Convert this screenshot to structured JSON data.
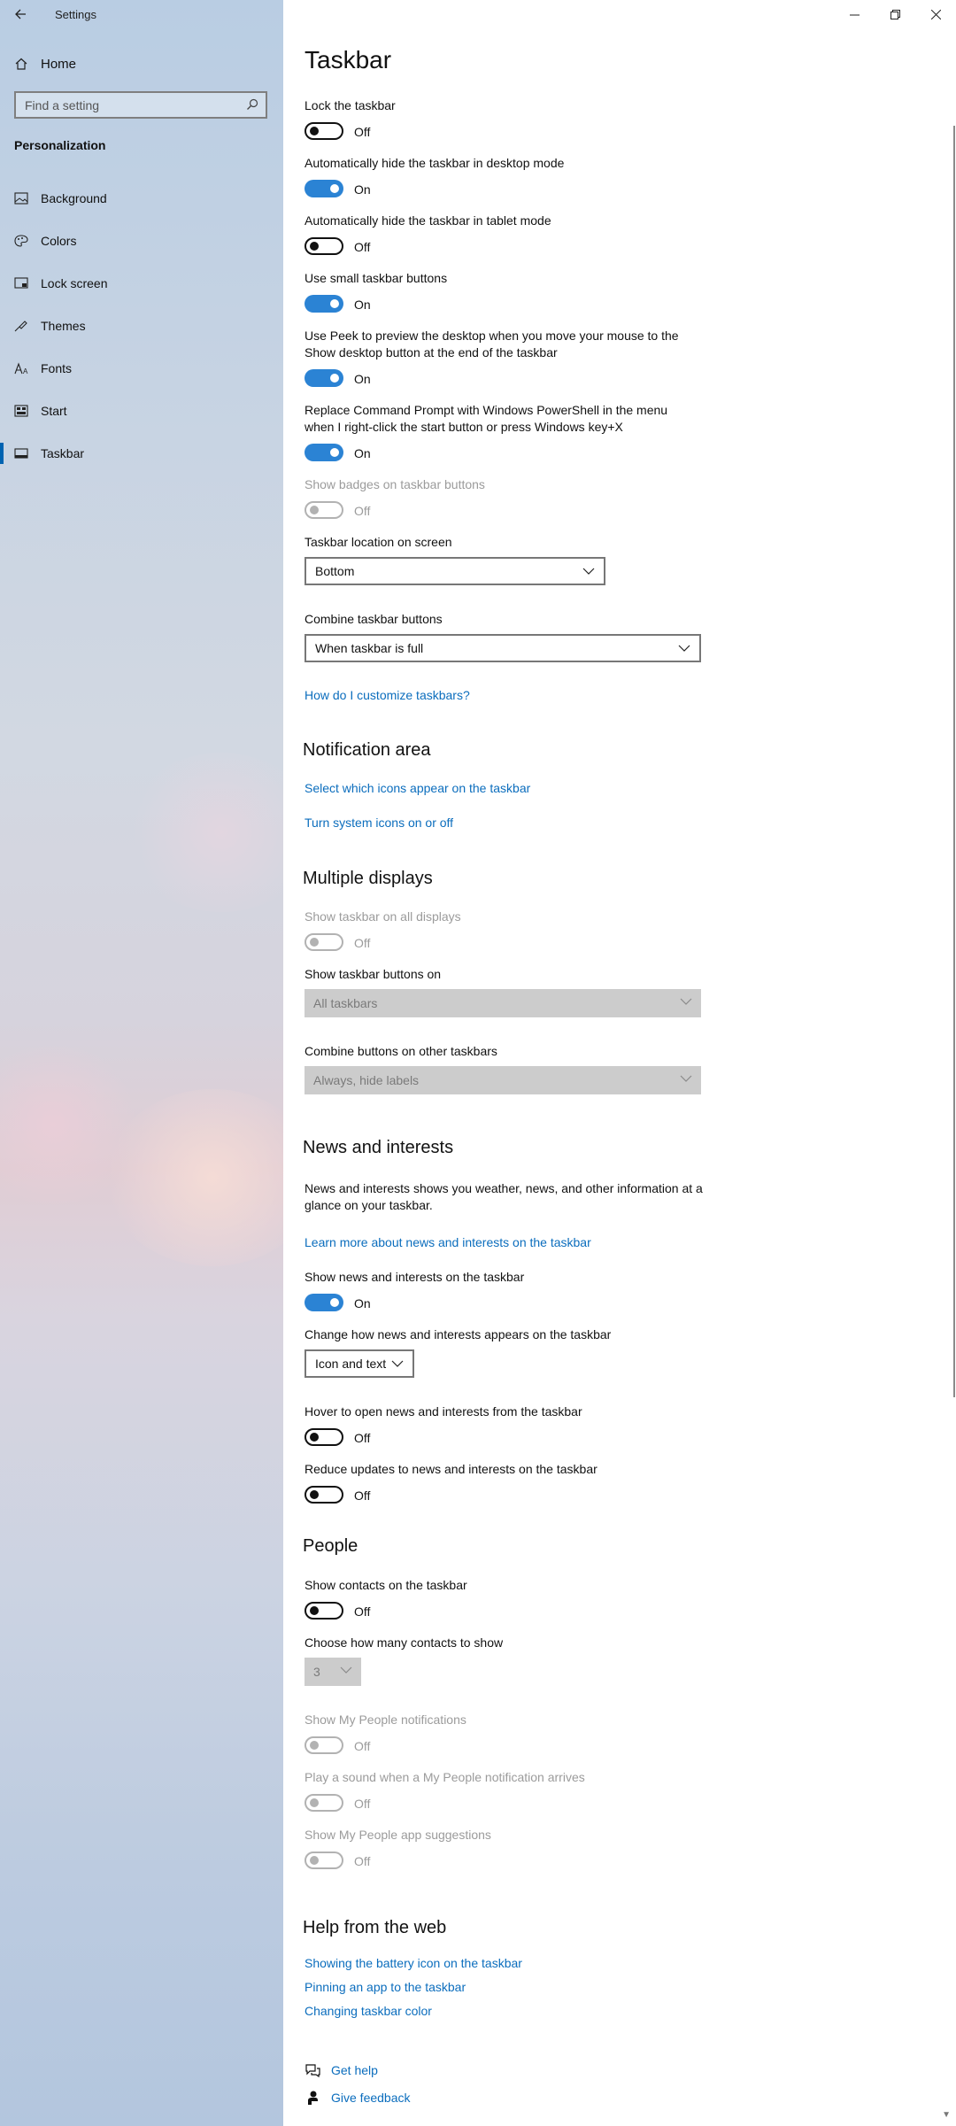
{
  "app": {
    "title": "Settings"
  },
  "sidebar": {
    "home_label": "Home",
    "search_placeholder": "Find a setting",
    "section_heading": "Personalization",
    "items": [
      {
        "label": "Background",
        "icon": "image-icon"
      },
      {
        "label": "Colors",
        "icon": "palette-icon"
      },
      {
        "label": "Lock screen",
        "icon": "lock-screen-icon"
      },
      {
        "label": "Themes",
        "icon": "themes-icon"
      },
      {
        "label": "Fonts",
        "icon": "fonts-icon"
      },
      {
        "label": "Start",
        "icon": "start-icon"
      },
      {
        "label": "Taskbar",
        "icon": "taskbar-icon",
        "selected": true
      }
    ]
  },
  "main": {
    "title": "Taskbar",
    "toggles": {
      "lock": {
        "label": "Lock the taskbar",
        "state": "Off"
      },
      "autohide_desktop": {
        "label": "Automatically hide the taskbar in desktop mode",
        "state": "On"
      },
      "autohide_tablet": {
        "label": "Automatically hide the taskbar in tablet mode",
        "state": "Off"
      },
      "small_buttons": {
        "label": "Use small taskbar buttons",
        "state": "On"
      },
      "peek": {
        "label": "Use Peek to preview the desktop when you move your mouse to the Show desktop button at the end of the taskbar",
        "state": "On"
      },
      "powershell": {
        "label": "Replace Command Prompt with Windows PowerShell in the menu when I right-click the start button or press Windows key+X",
        "state": "On"
      },
      "badges": {
        "label": "Show badges on taskbar buttons",
        "state": "Off"
      }
    },
    "location": {
      "label": "Taskbar location on screen",
      "value": "Bottom"
    },
    "combine": {
      "label": "Combine taskbar buttons",
      "value": "When taskbar is full"
    },
    "customize_link": "How do I customize taskbars?",
    "notification": {
      "heading": "Notification area",
      "link1": "Select which icons appear on the taskbar",
      "link2": "Turn system icons on or off"
    },
    "multiple": {
      "heading": "Multiple displays",
      "show_all": {
        "label": "Show taskbar on all displays",
        "state": "Off"
      },
      "buttons_on": {
        "label": "Show taskbar buttons on",
        "value": "All taskbars"
      },
      "combine_other": {
        "label": "Combine buttons on other taskbars",
        "value": "Always, hide labels"
      }
    },
    "news": {
      "heading": "News and interests",
      "description": "News and interests shows you weather, news, and other information at a glance on your taskbar.",
      "learn_more": "Learn more about news and interests on the taskbar",
      "show": {
        "label": "Show news and interests on the taskbar",
        "state": "On"
      },
      "appearance": {
        "label": "Change how news and interests appears on the taskbar",
        "value": "Icon and text"
      },
      "hover": {
        "label": "Hover to open news and interests from the taskbar",
        "state": "Off"
      },
      "reduce": {
        "label": "Reduce updates to news and interests on the taskbar",
        "state": "Off"
      }
    },
    "people": {
      "heading": "People",
      "show_contacts": {
        "label": "Show contacts on the taskbar",
        "state": "Off"
      },
      "count": {
        "label": "Choose how many contacts to show",
        "value": "3"
      },
      "notifications": {
        "label": "Show My People notifications",
        "state": "Off"
      },
      "sound": {
        "label": "Play a sound when a My People notification arrives",
        "state": "Off"
      },
      "suggestions": {
        "label": "Show My People app suggestions",
        "state": "Off"
      }
    },
    "help": {
      "heading": "Help from the web",
      "links": [
        "Showing the battery icon on the taskbar",
        "Pinning an app to the taskbar",
        "Changing taskbar color"
      ],
      "get_help": "Get help",
      "give_feedback": "Give feedback"
    }
  },
  "colors": {
    "accent": "#2b83d4",
    "link": "#0b6dbd",
    "disabled": "#9b9b9b"
  }
}
